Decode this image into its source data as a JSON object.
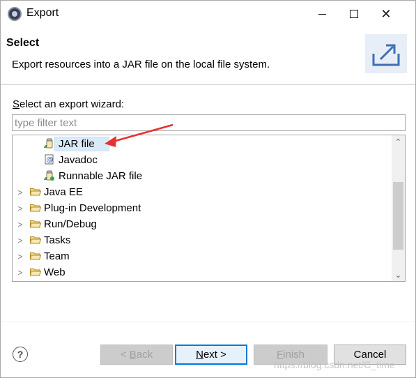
{
  "window": {
    "title": "Export",
    "controls": [
      "minimize",
      "maximize",
      "close"
    ]
  },
  "banner": {
    "title": "Select",
    "description": "Export resources into a JAR file on the local file system.",
    "icon": "export-wizard-icon"
  },
  "wizard": {
    "label_mnemonic": "S",
    "label_rest": "elect an export wizard:",
    "filter_placeholder": "type filter text",
    "tree": {
      "children": [
        {
          "label": "JAR file",
          "icon": "jar-icon",
          "selected": true
        },
        {
          "label": "Javadoc",
          "icon": "javadoc-icon"
        },
        {
          "label": "Runnable JAR file",
          "icon": "runnable-jar-icon"
        }
      ],
      "categories": [
        {
          "label": "Java EE",
          "icon": "folder-icon"
        },
        {
          "label": "Plug-in Development",
          "icon": "folder-icon"
        },
        {
          "label": "Run/Debug",
          "icon": "folder-icon"
        },
        {
          "label": "Tasks",
          "icon": "folder-icon"
        },
        {
          "label": "Team",
          "icon": "folder-icon"
        },
        {
          "label": "Web",
          "icon": "folder-icon"
        }
      ]
    }
  },
  "buttons": {
    "help": "?",
    "back_prefix": "< ",
    "back_mnemonic": "B",
    "back_rest": "ack",
    "next_mnemonic": "N",
    "next_rest": "ext >",
    "finish_mnemonic": "F",
    "finish_rest": "inish",
    "cancel": "Cancel"
  },
  "watermark": "https://blog.csdn.net/C_time",
  "colors": {
    "selection": "#d9ebf9",
    "default_button_border": "#0078d7",
    "annotation_arrow": "#e8312f"
  }
}
